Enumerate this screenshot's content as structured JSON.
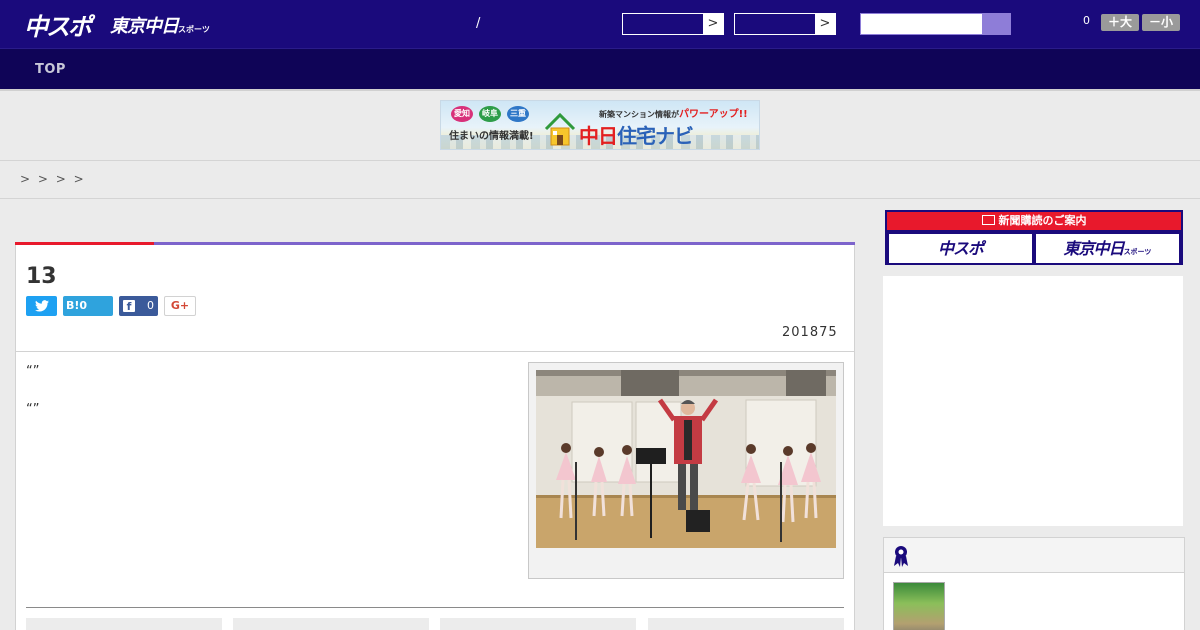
{
  "header": {
    "logo_primary": "中スポ",
    "logo_secondary": "東京中日",
    "logo_secondary_suffix": "スポーツ",
    "separator": "/",
    "select1_arrow": ">",
    "select2_arrow": ">",
    "search_value": "",
    "counter": "0",
    "font_larger": "＋大",
    "font_smaller": "－小"
  },
  "nav": {
    "items": [
      {
        "label": "TOP"
      }
    ]
  },
  "banner": {
    "pref1": "愛知",
    "pref2": "岐阜",
    "pref3": "三重",
    "tagline": "住まいの情報満載!",
    "headline_prefix": "新築マンション情報が",
    "headline_emph": "パワーアップ!!",
    "brand_main": "中日",
    "brand_rest": "住宅ナビ"
  },
  "breadcrumb": "> >   > >",
  "article": {
    "title": "13",
    "share": {
      "twitter_icon_label": "✔",
      "hatena_label": "B!",
      "hatena_count": "0",
      "facebook_icon_label": "f",
      "facebook_count": "0",
      "gplus_label": "G+"
    },
    "date": "201875",
    "paragraphs": [
      "“”",
      "“”"
    ]
  },
  "sidebar": {
    "subscribe_heading": "新聞購読のご案内",
    "subscribe_chunichi": "中スポ",
    "subscribe_tokyo": "東京中日",
    "subscribe_tokyo_suffix": "スポーツ"
  },
  "colors": {
    "header_bg": "#1a0a7c",
    "nav_bg": "#0f0457",
    "accent_red": "#e8192c",
    "accent_purple": "#7d64cc",
    "twitter": "#1ea1f2",
    "facebook": "#3b5a9a"
  }
}
